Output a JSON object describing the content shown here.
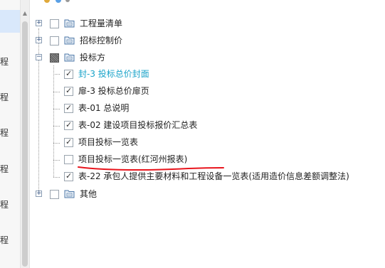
{
  "left_panel": {
    "labels": [
      "程",
      "程",
      "程",
      "程",
      "程",
      "程"
    ]
  },
  "tree": {
    "nodes": [
      {
        "label": "工程量清单",
        "level": 0,
        "expander": "+",
        "checked": false
      },
      {
        "label": "招标控制价",
        "level": 0,
        "expander": "+",
        "checked": false
      },
      {
        "label": "投标方",
        "level": 0,
        "expander": "-",
        "checked": "partial"
      },
      {
        "label": "封-3 投标总价封面",
        "level": 1,
        "checked": true,
        "active": true
      },
      {
        "label": "扉-3 投标总价扉页",
        "level": 1,
        "checked": true
      },
      {
        "label": "表-01 总说明",
        "level": 1,
        "checked": true
      },
      {
        "label": "表-02 建设项目投标报价汇总表",
        "level": 1,
        "checked": true
      },
      {
        "label": "项目投标一览表",
        "level": 1,
        "checked": true
      },
      {
        "label": "项目投标一览表(红河州报表)",
        "level": 1,
        "checked": false
      },
      {
        "label": "表-22 承包人提供主要材料和工程设备一览表(适用造价信息差额调整法)",
        "level": 1,
        "checked": true
      },
      {
        "label": "其他",
        "level": 0,
        "expander": "+",
        "checked": false
      }
    ]
  },
  "colors": {
    "active_text": "#1aa3c9",
    "annotation": "#e8141c",
    "selection": "#d9e8fb"
  },
  "icons": [
    "folder-report-icon",
    "expand-plus-icon",
    "collapse-minus-icon",
    "checkmark-icon"
  ]
}
